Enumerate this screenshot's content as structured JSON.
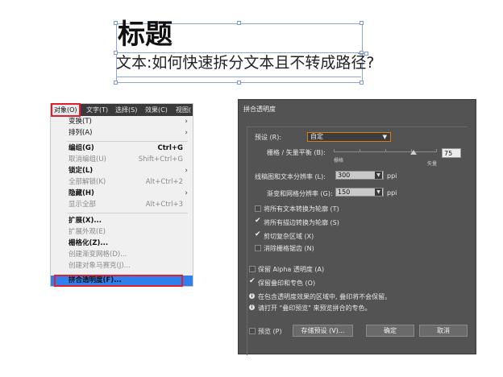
{
  "textframe": {
    "title": "标题",
    "body": "文本:如何快速拆分文本且不转成路径?"
  },
  "menu": {
    "menubar": [
      "对象(O)",
      "文字(T)",
      "选择(S)",
      "效果(C)",
      "视图("
    ],
    "items": [
      {
        "label": "变换(T)",
        "shortcut": "",
        "submenu": true,
        "enabled": true
      },
      {
        "label": "排列(A)",
        "shortcut": "",
        "submenu": true,
        "enabled": true
      },
      {
        "label": "编组(G)",
        "shortcut": "Ctrl+G",
        "submenu": false,
        "enabled": true
      },
      {
        "label": "取消编组(U)",
        "shortcut": "Shift+Ctrl+G",
        "submenu": false,
        "enabled": false
      },
      {
        "label": "锁定(L)",
        "shortcut": "",
        "submenu": true,
        "enabled": true
      },
      {
        "label": "全部解锁(K)",
        "shortcut": "Alt+Ctrl+2",
        "submenu": false,
        "enabled": false
      },
      {
        "label": "隐藏(H)",
        "shortcut": "",
        "submenu": true,
        "enabled": true
      },
      {
        "label": "显示全部",
        "shortcut": "Alt+Ctrl+3",
        "submenu": false,
        "enabled": false
      },
      {
        "label": "扩展(X)...",
        "shortcut": "",
        "submenu": false,
        "enabled": true
      },
      {
        "label": "扩展外观(E)",
        "shortcut": "",
        "submenu": false,
        "enabled": false
      },
      {
        "label": "栅格化(Z)...",
        "shortcut": "",
        "submenu": false,
        "enabled": true
      },
      {
        "label": "创建渐变网格(D)...",
        "shortcut": "",
        "submenu": false,
        "enabled": false
      },
      {
        "label": "创建对象马赛克(J)...",
        "shortcut": "",
        "submenu": false,
        "enabled": false
      },
      {
        "label": "拼合透明度(F)...",
        "shortcut": "",
        "submenu": false,
        "enabled": true,
        "selected": true
      }
    ]
  },
  "dialog": {
    "title": "拼合透明度",
    "preset_label": "预设 (R):",
    "preset_value": "自定",
    "balance_label": "栅格 / 矢量平衡 (B):",
    "balance_value": "75",
    "balance_left": "栅格",
    "balance_right": "矢量",
    "line_res_label": "线稿图和文本分辨率 (L):",
    "line_res_value": "300",
    "grad_res_label": "渐变和网格分辨率 (G):",
    "grad_res_value": "150",
    "unit": "ppi",
    "checkboxes": [
      {
        "label": "将所有文本转换为轮廓 (T)",
        "checked": false
      },
      {
        "label": "将所有描边转换为轮廓 (S)",
        "checked": true
      },
      {
        "label": "剪切复杂区域 (X)",
        "checked": true
      },
      {
        "label": "消除栅格锯齿 (N)",
        "checked": false
      }
    ],
    "keep_alpha": {
      "label": "保留 Alpha 透明度 (A)",
      "checked": false
    },
    "keep_overprint": {
      "label": "保留叠印和专色 (O)",
      "checked": true
    },
    "info1": "在包含透明度效果的区域中, 叠印将不会保留。",
    "info2": "请打开 \"叠印预览\" 来预览拼合的专色。",
    "preview_label": "预览 (P)",
    "save_preset_label": "存储预设 (V)...",
    "ok_label": "确定",
    "cancel_label": "取消"
  }
}
